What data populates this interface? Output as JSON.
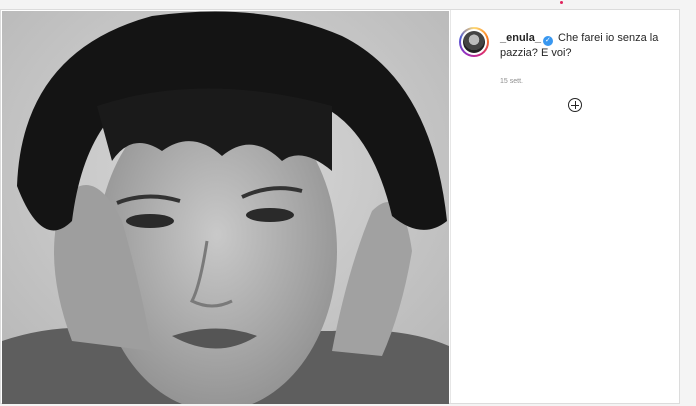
{
  "post": {
    "username": "_enula_",
    "verified_icon": "verified-badge-icon",
    "caption": "Che farei io senza la pazzia? E voi?",
    "timestamp": "15 sett.",
    "add_icon": "plus-circle-icon",
    "photo_icon": "photo-image"
  },
  "colors": {
    "verified": "#3897f0",
    "text": "#262626",
    "muted": "#8e8e8e",
    "accent_dot": "#e0245e"
  }
}
